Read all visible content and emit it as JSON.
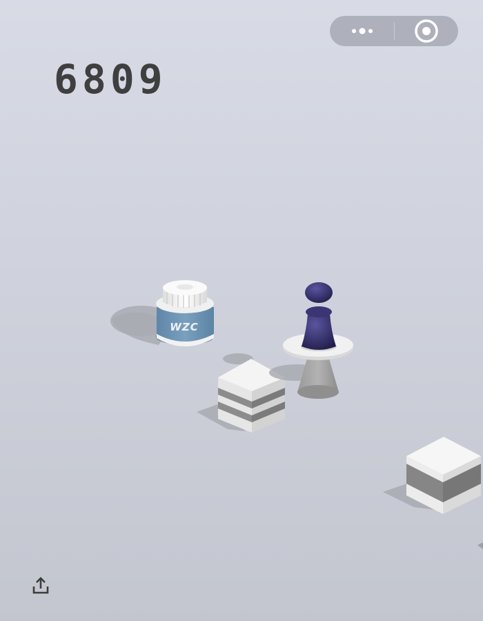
{
  "hud": {
    "score": "6809"
  },
  "capsule": {
    "more_icon": "more-dots-icon",
    "close_icon": "target-close-icon"
  },
  "jar": {
    "label": "WZC"
  },
  "share_icon": "share-upload-icon",
  "colors": {
    "background_top": "#d8dbe5",
    "background_bottom": "#c3c6cf",
    "score": "#3f3f3f",
    "jar_body": "#6f95b6",
    "player": "#2e2a5e",
    "block_light": "#efefef",
    "block_dark": "#8c8c8c"
  }
}
